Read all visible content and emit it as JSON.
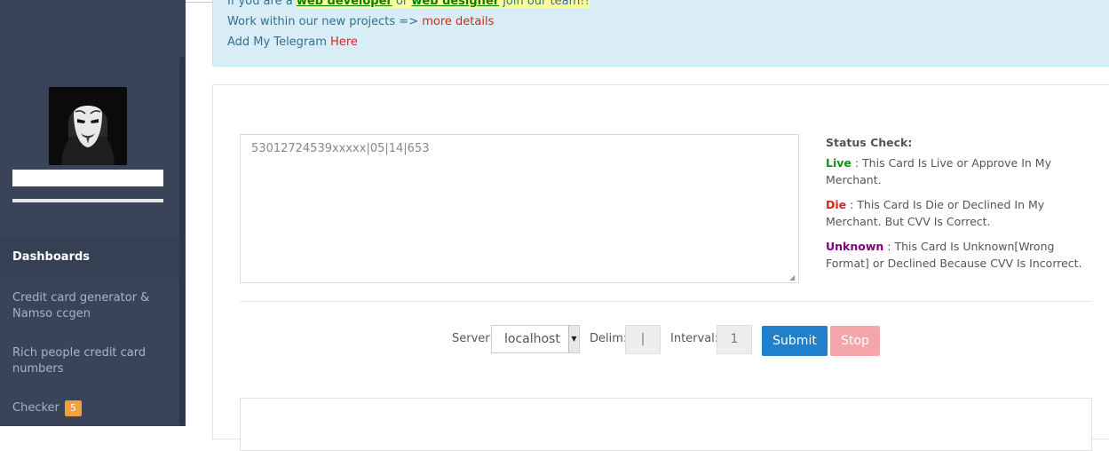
{
  "sidebar": {
    "nav": [
      {
        "label": "Dashboards"
      },
      {
        "label": "Credit card generator & Namso ccgen"
      },
      {
        "label": "Rich people credit card numbers"
      },
      {
        "label": "Checker",
        "badge": "5"
      }
    ]
  },
  "alert": {
    "line1_prefix": "If you are a ",
    "line1_link1": "web developer",
    "line1_mid": " or ",
    "line1_link2": "web designer",
    "line1_suffix": " join our team!!",
    "line2_text": "Work within our new projects => ",
    "line2_link": "more details",
    "line3_text": "Add My Telegram ",
    "line3_link": "Here"
  },
  "checker": {
    "cards_value": "53012724539xxxxx|05|14|653",
    "status_title": "Status Check:",
    "live_label": "Live",
    "live_desc": " : This Card Is Live or Approve In My Merchant.",
    "die_label": "Die",
    "die_desc": " : This Card Is Die or Declined In My Merchant. But CVV Is Correct.",
    "unknown_label": "Unknown",
    "unknown_desc": " : This Card Is Unknown[Wrong Format] or Declined Because CVV Is Incorrect."
  },
  "controls": {
    "server_label": "Server:",
    "server_value": "localhost",
    "delim_label": "Delim:",
    "delim_value": "|",
    "interval_label": "Interval:",
    "interval_value": "1",
    "submit_label": "Submit",
    "stop_label": "Stop"
  }
}
